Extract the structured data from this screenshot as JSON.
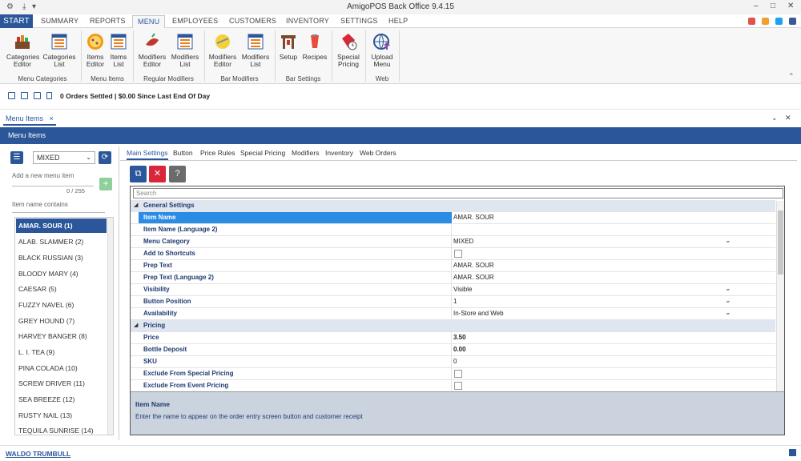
{
  "window": {
    "title": "AmigoPOS Back Office 9.4.15"
  },
  "menu_tabs": {
    "start": "START",
    "items": [
      "SUMMARY",
      "REPORTS",
      "MENU",
      "EMPLOYEES",
      "CUSTOMERS",
      "INVENTORY",
      "SETTINGS",
      "HELP"
    ],
    "active": "MENU"
  },
  "ribbon": {
    "buttons": [
      {
        "label1": "Categories",
        "label2": "Editor",
        "icon": "categories-editor-icon"
      },
      {
        "label1": "Categories",
        "label2": "List",
        "icon": "categories-list-icon"
      },
      {
        "label1": "Items",
        "label2": "Editor",
        "icon": "items-editor-icon"
      },
      {
        "label1": "Items",
        "label2": "List",
        "icon": "items-list-icon"
      },
      {
        "label1": "Modifiers",
        "label2": "Editor",
        "icon": "modifiers-editor-icon"
      },
      {
        "label1": "Modifiers",
        "label2": "List",
        "icon": "modifiers-list-icon"
      },
      {
        "label1": "Modifiers",
        "label2": "Editor",
        "icon": "bar-modifiers-editor-icon"
      },
      {
        "label1": "Modifiers",
        "label2": "List",
        "icon": "bar-modifiers-list-icon"
      },
      {
        "label1": "Setup",
        "label2": "",
        "icon": "bar-setup-icon"
      },
      {
        "label1": "Recipes",
        "label2": "",
        "icon": "recipes-icon"
      },
      {
        "label1": "Special",
        "label2": "Pricing",
        "icon": "special-pricing-icon"
      },
      {
        "label1": "Upload",
        "label2": "Menu",
        "icon": "upload-menu-icon"
      }
    ],
    "groups": [
      "Menu Categories",
      "Menu Items",
      "Regular Modifiers",
      "Bar Modifiers",
      "Bar Settings",
      "Web"
    ]
  },
  "status": {
    "text": "0 Orders Settled | $0.00 Since Last End Of Day"
  },
  "doc_tab": {
    "label": "Menu Items",
    "close": "×"
  },
  "panel_title": "Menu Items",
  "left": {
    "category_value": "MIXED",
    "add_placeholder": "Add a new menu item",
    "char_count": "0 / 255",
    "filter_label": "Item name contains",
    "items": [
      "AMAR. SOUR (1)",
      "ALAB. SLAMMER (2)",
      "BLACK RUSSIAN (3)",
      "BLOODY MARY (4)",
      "CAESAR (5)",
      "FUZZY NAVEL (6)",
      "GREY HOUND (7)",
      "HARVEY BANGER (8)",
      "L. I. TEA (9)",
      "PINA COLADA (10)",
      "SCREW DRIVER (11)",
      "SEA BREEZE (12)",
      "RUSTY NAIL (13)",
      "TEQUILA SUNRISE (14)"
    ],
    "selected_index": 0
  },
  "sub_tabs": [
    "Main Settings",
    "Button",
    "Price Rules",
    "Special Pricing",
    "Modifiers",
    "Inventory",
    "Web Orders"
  ],
  "grid": {
    "search_placeholder": "Search",
    "rows": [
      {
        "type": "cat",
        "key": "General Settings"
      },
      {
        "type": "prop",
        "key": "Item Name",
        "value": "AMAR. SOUR",
        "selected": true
      },
      {
        "type": "prop",
        "key": "Item Name (Language 2)",
        "value": ""
      },
      {
        "type": "prop",
        "key": "Menu Category",
        "value": "MIXED",
        "dropdown": true
      },
      {
        "type": "prop",
        "key": "Add to Shortcuts",
        "value": "",
        "checkbox": true
      },
      {
        "type": "prop",
        "key": "Prep Text",
        "value": "AMAR. SOUR"
      },
      {
        "type": "prop",
        "key": "Prep Text (Language 2)",
        "value": "AMAR. SOUR"
      },
      {
        "type": "prop",
        "key": "Visibility",
        "value": "Visible",
        "dropdown": true
      },
      {
        "type": "prop",
        "key": "Button Position",
        "value": "1",
        "dropdown": true
      },
      {
        "type": "prop",
        "key": "Availability",
        "value": "In-Store and Web",
        "dropdown": true
      },
      {
        "type": "cat",
        "key": "Pricing"
      },
      {
        "type": "prop",
        "key": "Price",
        "value": "3.50",
        "bold": true
      },
      {
        "type": "prop",
        "key": "Bottle Deposit",
        "value": "0.00",
        "bold": true
      },
      {
        "type": "prop",
        "key": "SKU",
        "value": "0"
      },
      {
        "type": "prop",
        "key": "Exclude From Special Pricing",
        "value": "",
        "checkbox": true
      },
      {
        "type": "prop",
        "key": "Exclude From Event Pricing",
        "value": "",
        "checkbox": true
      }
    ]
  },
  "description": {
    "title": "Item Name",
    "text": "Enter the name to appear on the order entry screen button and customer receipt"
  },
  "footer": {
    "user": "WALDO TRUMBULL"
  },
  "colors": {
    "accent": "#2b579a",
    "delete": "#d9263a",
    "help": "#6b6b6b",
    "add": "#8fcf9a"
  }
}
